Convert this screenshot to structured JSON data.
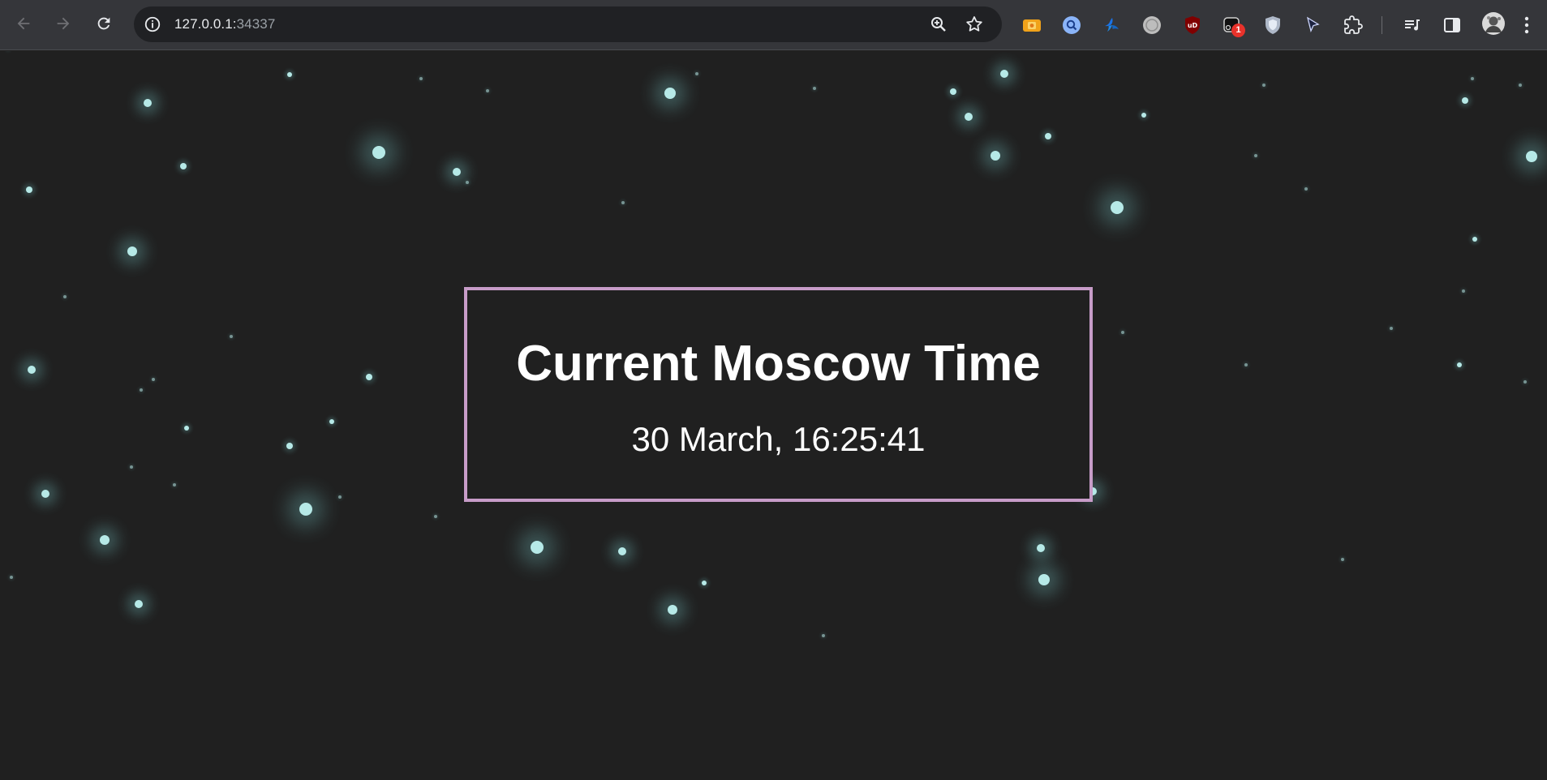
{
  "browser": {
    "url_host": "127.0.0.1:",
    "url_port": "34337",
    "profile_badge_count": "1",
    "icons": {
      "back": "arrow-left-icon",
      "forward": "arrow-right-icon",
      "reload": "reload-icon",
      "site_info": "info-icon",
      "zoom": "zoom-in-icon",
      "bookmark": "star-outline-icon",
      "extensions": "puzzle-icon",
      "reading_list": "queue-music-icon",
      "side_panel": "side-panel-icon",
      "menu": "kebab-menu-icon"
    },
    "colors": {
      "toolbar": "#35363a",
      "omnibox": "#202124"
    }
  },
  "page": {
    "title": "Current Moscow Time",
    "time": "30 March, 16:25:41",
    "colors": {
      "background": "#202020",
      "border": "#c79cc8",
      "star": "#bff4f2"
    }
  }
}
